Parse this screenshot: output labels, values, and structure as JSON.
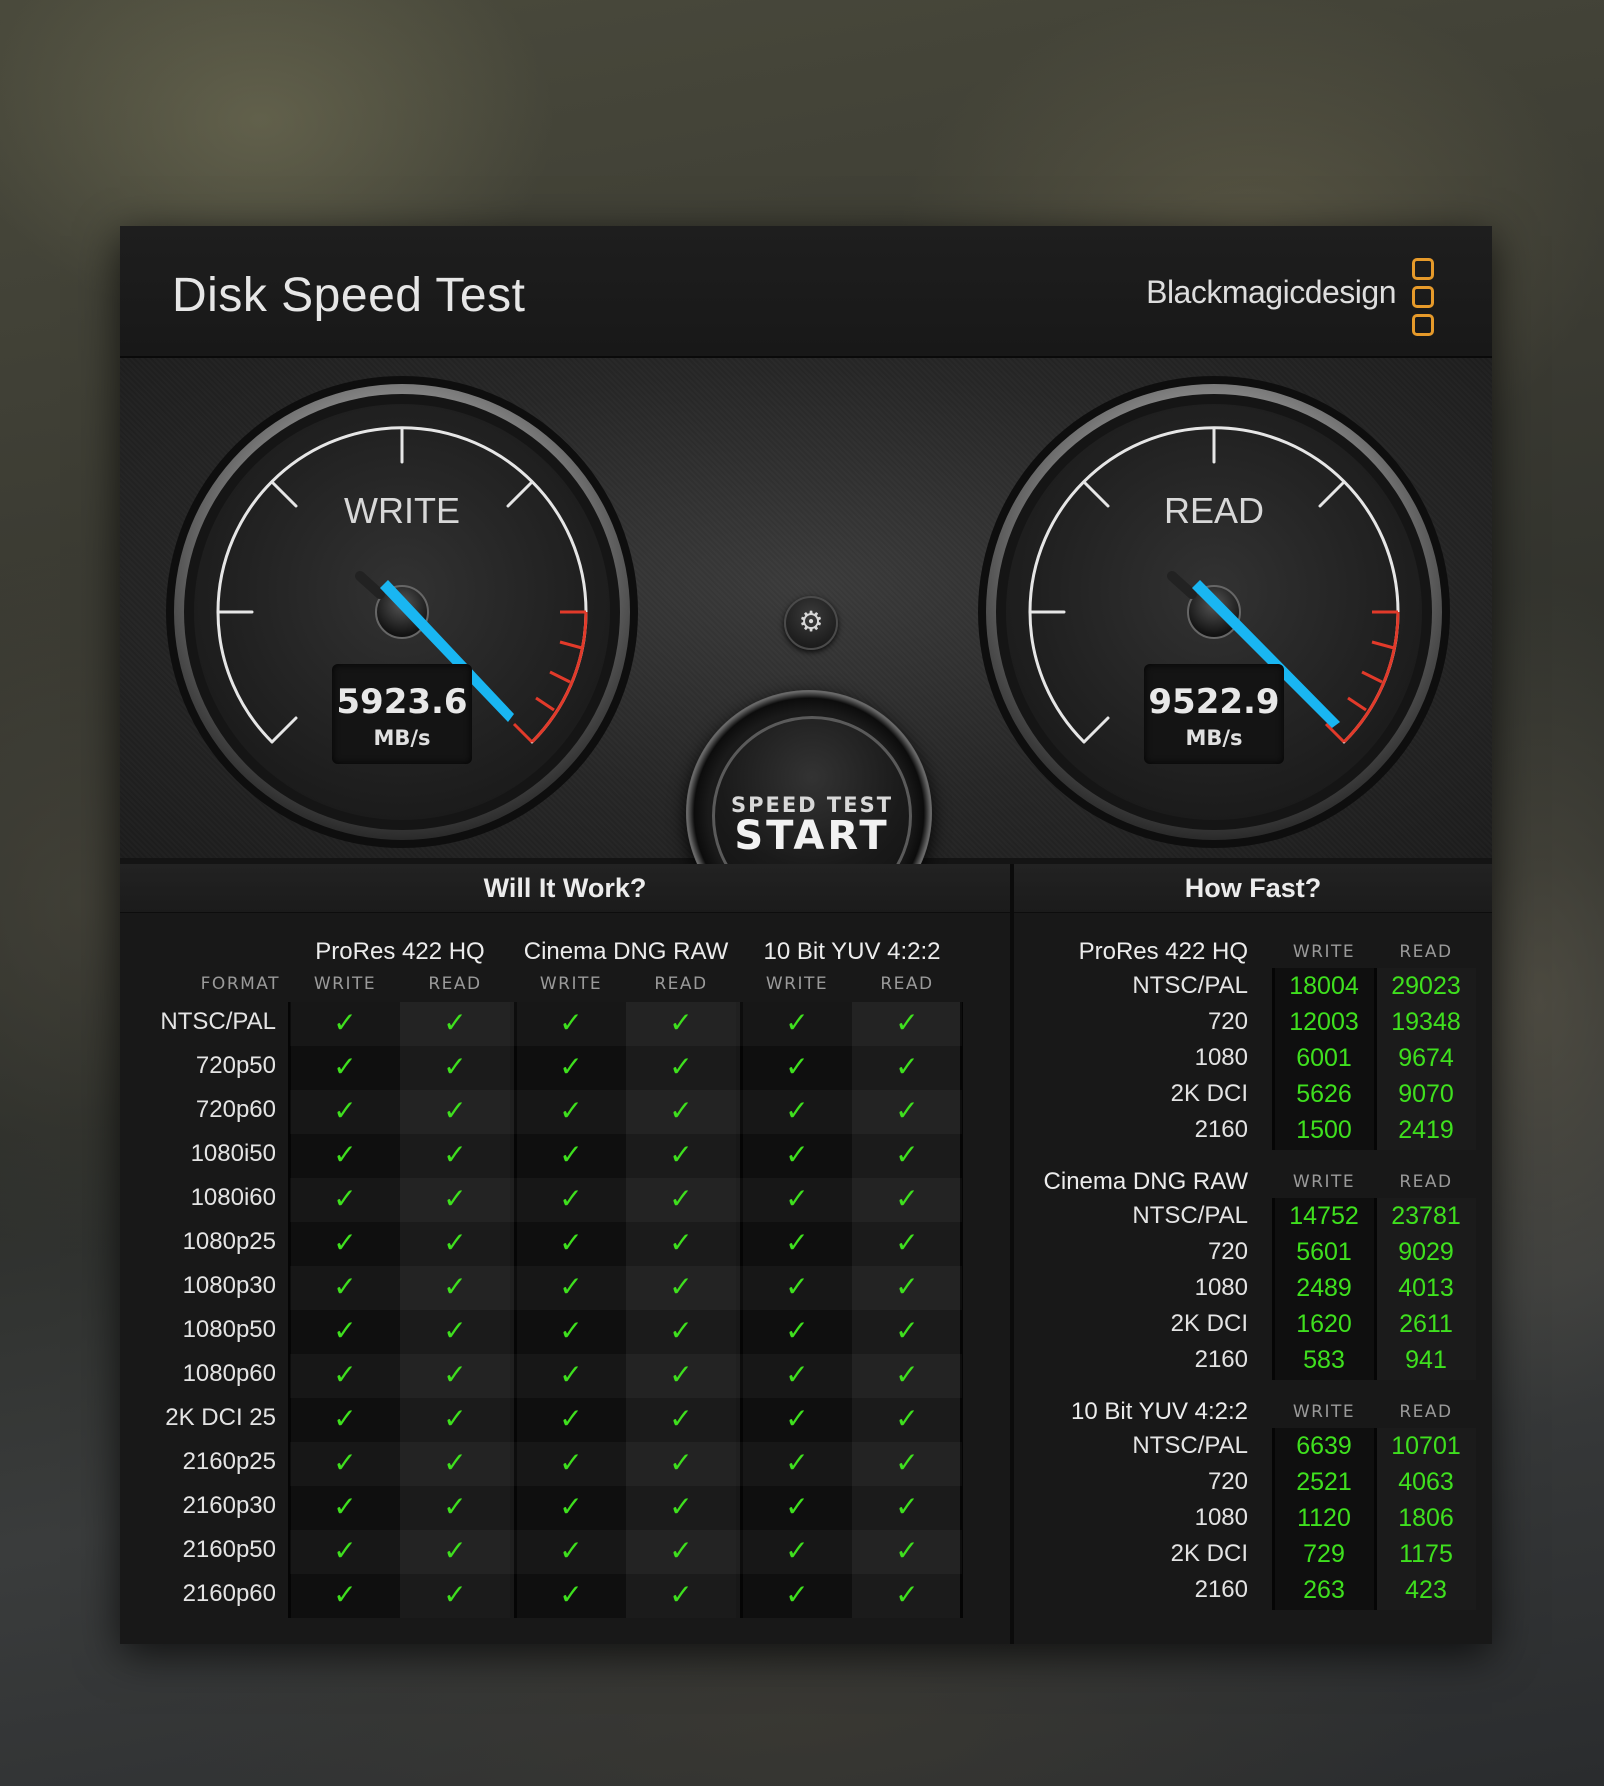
{
  "window": {
    "title": "Disk Speed Test",
    "brand": "Blackmagicdesign",
    "close_symbol": "×"
  },
  "write_gauge": {
    "label": "WRITE",
    "value": "5923.6",
    "unit": "MB/s"
  },
  "read_gauge": {
    "label": "READ",
    "value": "9522.9",
    "unit": "MB/s"
  },
  "start_button": {
    "small": "SPEED TEST",
    "big": "START"
  },
  "settings_icon": "gear-icon",
  "will_it_work": {
    "title": "Will It Work?",
    "format_label": "FORMAT",
    "write_label": "WRITE",
    "read_label": "READ",
    "codecs": [
      "ProRes 422 HQ",
      "Cinema DNG RAW",
      "10 Bit YUV 4:2:2"
    ],
    "check_symbol": "✓",
    "formats": [
      "NTSC/PAL",
      "720p50",
      "720p60",
      "1080i50",
      "1080i60",
      "1080p25",
      "1080p30",
      "1080p50",
      "1080p60",
      "2K DCI 25",
      "2160p25",
      "2160p30",
      "2160p50",
      "2160p60"
    ]
  },
  "how_fast": {
    "title": "How Fast?",
    "write_label": "WRITE",
    "read_label": "READ",
    "groups": [
      {
        "codec": "ProRes 422 HQ",
        "rows": [
          {
            "label": "NTSC/PAL",
            "write": "18004",
            "read": "29023"
          },
          {
            "label": "720",
            "write": "12003",
            "read": "19348"
          },
          {
            "label": "1080",
            "write": "6001",
            "read": "9674"
          },
          {
            "label": "2K DCI",
            "write": "5626",
            "read": "9070"
          },
          {
            "label": "2160",
            "write": "1500",
            "read": "2419"
          }
        ]
      },
      {
        "codec": "Cinema DNG RAW",
        "rows": [
          {
            "label": "NTSC/PAL",
            "write": "14752",
            "read": "23781"
          },
          {
            "label": "720",
            "write": "5601",
            "read": "9029"
          },
          {
            "label": "1080",
            "write": "2489",
            "read": "4013"
          },
          {
            "label": "2K DCI",
            "write": "1620",
            "read": "2611"
          },
          {
            "label": "2160",
            "write": "583",
            "read": "941"
          }
        ]
      },
      {
        "codec": "10 Bit YUV 4:2:2",
        "rows": [
          {
            "label": "NTSC/PAL",
            "write": "6639",
            "read": "10701"
          },
          {
            "label": "720",
            "write": "2521",
            "read": "4063"
          },
          {
            "label": "1080",
            "write": "1120",
            "read": "1806"
          },
          {
            "label": "2K DCI",
            "write": "729",
            "read": "1175"
          },
          {
            "label": "2160",
            "write": "263",
            "read": "423"
          }
        ]
      }
    ]
  },
  "colors": {
    "needle": "#19b6f2",
    "redzone": "#e23a2a",
    "check": "#3fe01e",
    "logo": "#e69a2a"
  }
}
